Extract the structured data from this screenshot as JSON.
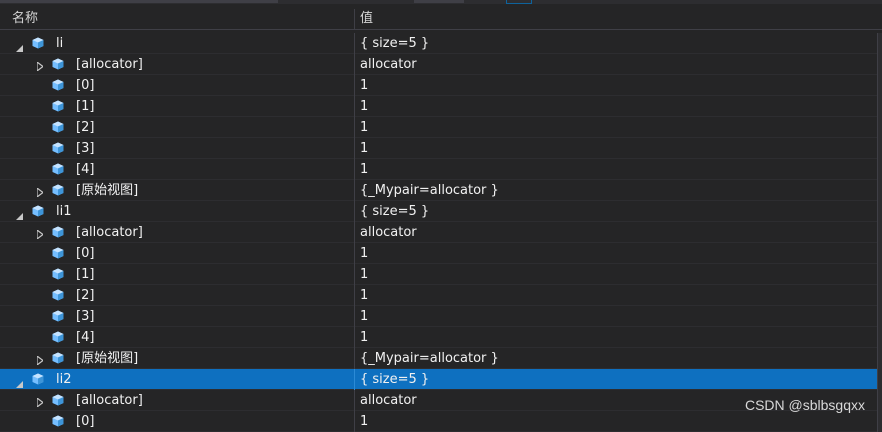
{
  "header": {
    "name_col": "名称",
    "value_col": "值"
  },
  "rows": [
    {
      "name": "li",
      "value": "{ size=5 }",
      "level": 0,
      "expander": "expanded"
    },
    {
      "name": "[allocator]",
      "value": "allocator",
      "level": 1,
      "expander": "collapsed"
    },
    {
      "name": "[0]",
      "value": "1",
      "level": 1,
      "expander": "none"
    },
    {
      "name": "[1]",
      "value": "1",
      "level": 1,
      "expander": "none"
    },
    {
      "name": "[2]",
      "value": "1",
      "level": 1,
      "expander": "none"
    },
    {
      "name": "[3]",
      "value": "1",
      "level": 1,
      "expander": "none"
    },
    {
      "name": "[4]",
      "value": "1",
      "level": 1,
      "expander": "none"
    },
    {
      "name": "[原始视图]",
      "value": "{_Mypair=allocator }",
      "level": 1,
      "expander": "collapsed"
    },
    {
      "name": "li1",
      "value": "{ size=5 }",
      "level": 0,
      "expander": "expanded"
    },
    {
      "name": "[allocator]",
      "value": "allocator",
      "level": 1,
      "expander": "collapsed"
    },
    {
      "name": "[0]",
      "value": "1",
      "level": 1,
      "expander": "none"
    },
    {
      "name": "[1]",
      "value": "1",
      "level": 1,
      "expander": "none"
    },
    {
      "name": "[2]",
      "value": "1",
      "level": 1,
      "expander": "none"
    },
    {
      "name": "[3]",
      "value": "1",
      "level": 1,
      "expander": "none"
    },
    {
      "name": "[4]",
      "value": "1",
      "level": 1,
      "expander": "none"
    },
    {
      "name": "[原始视图]",
      "value": "{_Mypair=allocator }",
      "level": 1,
      "expander": "collapsed"
    },
    {
      "name": "li2",
      "value": "{ size=5 }",
      "level": 0,
      "expander": "expanded",
      "selected": true
    },
    {
      "name": "[allocator]",
      "value": "allocator",
      "level": 1,
      "expander": "collapsed"
    },
    {
      "name": "[0]",
      "value": "1",
      "level": 1,
      "expander": "none"
    }
  ],
  "watermark": "CSDN @sblbsgqxx",
  "icons": {
    "expanded": "triangle-down-icon",
    "collapsed": "triangle-right-icon",
    "object": "object-cube-icon"
  },
  "colors": {
    "selected_row": "#0e70c0",
    "icon_blue": "#75beff",
    "background": "#252526"
  }
}
